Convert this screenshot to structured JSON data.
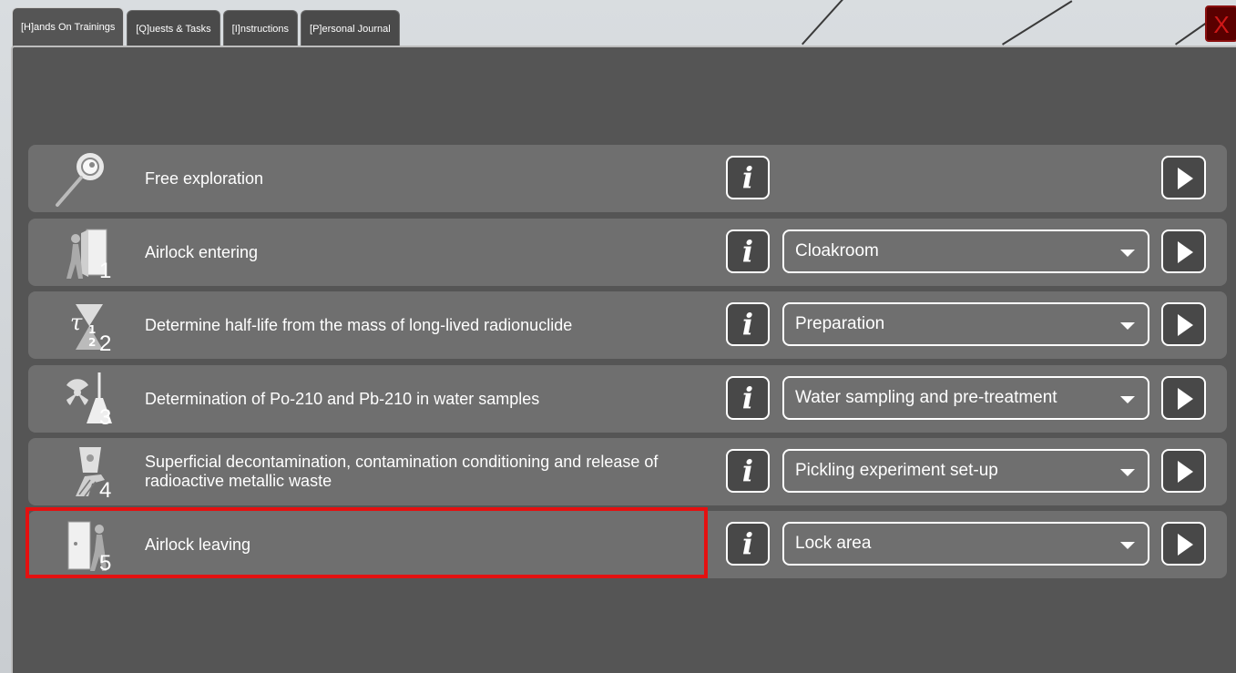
{
  "tabs": [
    {
      "label": "[H]ands On Trainings"
    },
    {
      "label": "[Q]uests & Tasks"
    },
    {
      "label": "[I]nstructions"
    },
    {
      "label": "[P]ersonal Journal"
    }
  ],
  "close_label": "X",
  "info_glyph": "i",
  "trainings": [
    {
      "title": "Free exploration",
      "number": "",
      "icon": "magnifier-icon",
      "dropdown": null
    },
    {
      "title": "Airlock entering",
      "number": "1",
      "icon": "person-entering-door-icon",
      "dropdown": "Cloakroom"
    },
    {
      "title": "Determine half-life from the mass of long-lived radionuclide",
      "number": "2",
      "icon": "half-life-hourglass-icon",
      "dropdown": "Preparation"
    },
    {
      "title": "Determination of Po-210 and Pb-210 in water samples",
      "number": "3",
      "icon": "radiation-flask-icon",
      "dropdown": "Water sampling and pre-treatment"
    },
    {
      "title": "Superficial decontamination, contamination conditioning and release of radioactive metallic waste",
      "number": "4",
      "icon": "radioactive-waste-hand-icon",
      "dropdown": "Pickling experiment set-up"
    },
    {
      "title": "Airlock leaving",
      "number": "5",
      "icon": "person-leaving-door-icon",
      "dropdown": "Lock area"
    }
  ],
  "highlighted_row": 5,
  "colors": {
    "highlight": "#e41010",
    "panel": "#555555",
    "row": "#6f6f6f"
  }
}
